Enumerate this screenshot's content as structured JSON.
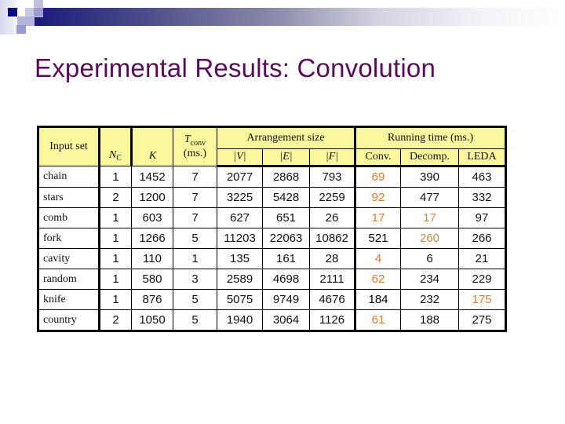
{
  "slide": {
    "title": "Experimental Results: Convolution",
    "decoration": "squares-and-gradient-bar",
    "colors": {
      "title": "#5a0a5a",
      "header_bg": "#fbf79c",
      "highlight_best": "#e07a2a",
      "highlight_light": "#c8874a"
    }
  },
  "table": {
    "headers": {
      "input_set": "Input set",
      "nc_main": "N",
      "nc_sub": "C",
      "k": "K",
      "tconv_main": "T",
      "tconv_sub": "conv",
      "tconv_unit": "(ms.)",
      "arrangement_group": "Arrangement size",
      "v": "|V|",
      "e": "|E|",
      "f": "|F|",
      "running_group": "Running time (ms.)",
      "conv": "Conv.",
      "decomp": "Decomp.",
      "leda": "LEDA"
    },
    "rows": [
      {
        "name": "chain",
        "nc": "1",
        "k": "1452",
        "tconv": "7",
        "v": "2077",
        "e": "2868",
        "f": "793",
        "conv": "69",
        "decomp": "390",
        "leda": "463",
        "conv_style": "hl-bold",
        "decomp_style": "",
        "leda_style": ""
      },
      {
        "name": "stars",
        "nc": "2",
        "k": "1200",
        "tconv": "7",
        "v": "3225",
        "e": "5428",
        "f": "2259",
        "conv": "92",
        "decomp": "477",
        "leda": "332",
        "conv_style": "hl-bold",
        "decomp_style": "",
        "leda_style": ""
      },
      {
        "name": "comb",
        "nc": "1",
        "k": "603",
        "tconv": "7",
        "v": "627",
        "e": "651",
        "f": "26",
        "conv": "17",
        "decomp": "17",
        "leda": "97",
        "conv_style": "hl-bold",
        "decomp_style": "hl-light",
        "leda_style": ""
      },
      {
        "name": "fork",
        "nc": "1",
        "k": "1266",
        "tconv": "5",
        "v": "11203",
        "e": "22063",
        "f": "10862",
        "conv": "521",
        "decomp": "260",
        "leda": "266",
        "conv_style": "bold-black",
        "decomp_style": "hl-light",
        "leda_style": ""
      },
      {
        "name": "cavity",
        "nc": "1",
        "k": "110",
        "tconv": "1",
        "v": "135",
        "e": "161",
        "f": "28",
        "conv": "4",
        "decomp": "6",
        "leda": "21",
        "conv_style": "hl-bold",
        "decomp_style": "",
        "leda_style": ""
      },
      {
        "name": "random",
        "nc": "1",
        "k": "580",
        "tconv": "3",
        "v": "2589",
        "e": "4698",
        "f": "2111",
        "conv": "62",
        "decomp": "234",
        "leda": "229",
        "conv_style": "hl-bold",
        "decomp_style": "",
        "leda_style": ""
      },
      {
        "name": "knife",
        "nc": "1",
        "k": "876",
        "tconv": "5",
        "v": "5075",
        "e": "9749",
        "f": "4676",
        "conv": "184",
        "decomp": "232",
        "leda": "175",
        "conv_style": "bold-black",
        "decomp_style": "",
        "leda_style": "hl-bold"
      },
      {
        "name": "country",
        "nc": "2",
        "k": "1050",
        "tconv": "5",
        "v": "1940",
        "e": "3064",
        "f": "1126",
        "conv": "61",
        "decomp": "188",
        "leda": "275",
        "conv_style": "hl-bold",
        "decomp_style": "",
        "leda_style": ""
      }
    ]
  }
}
